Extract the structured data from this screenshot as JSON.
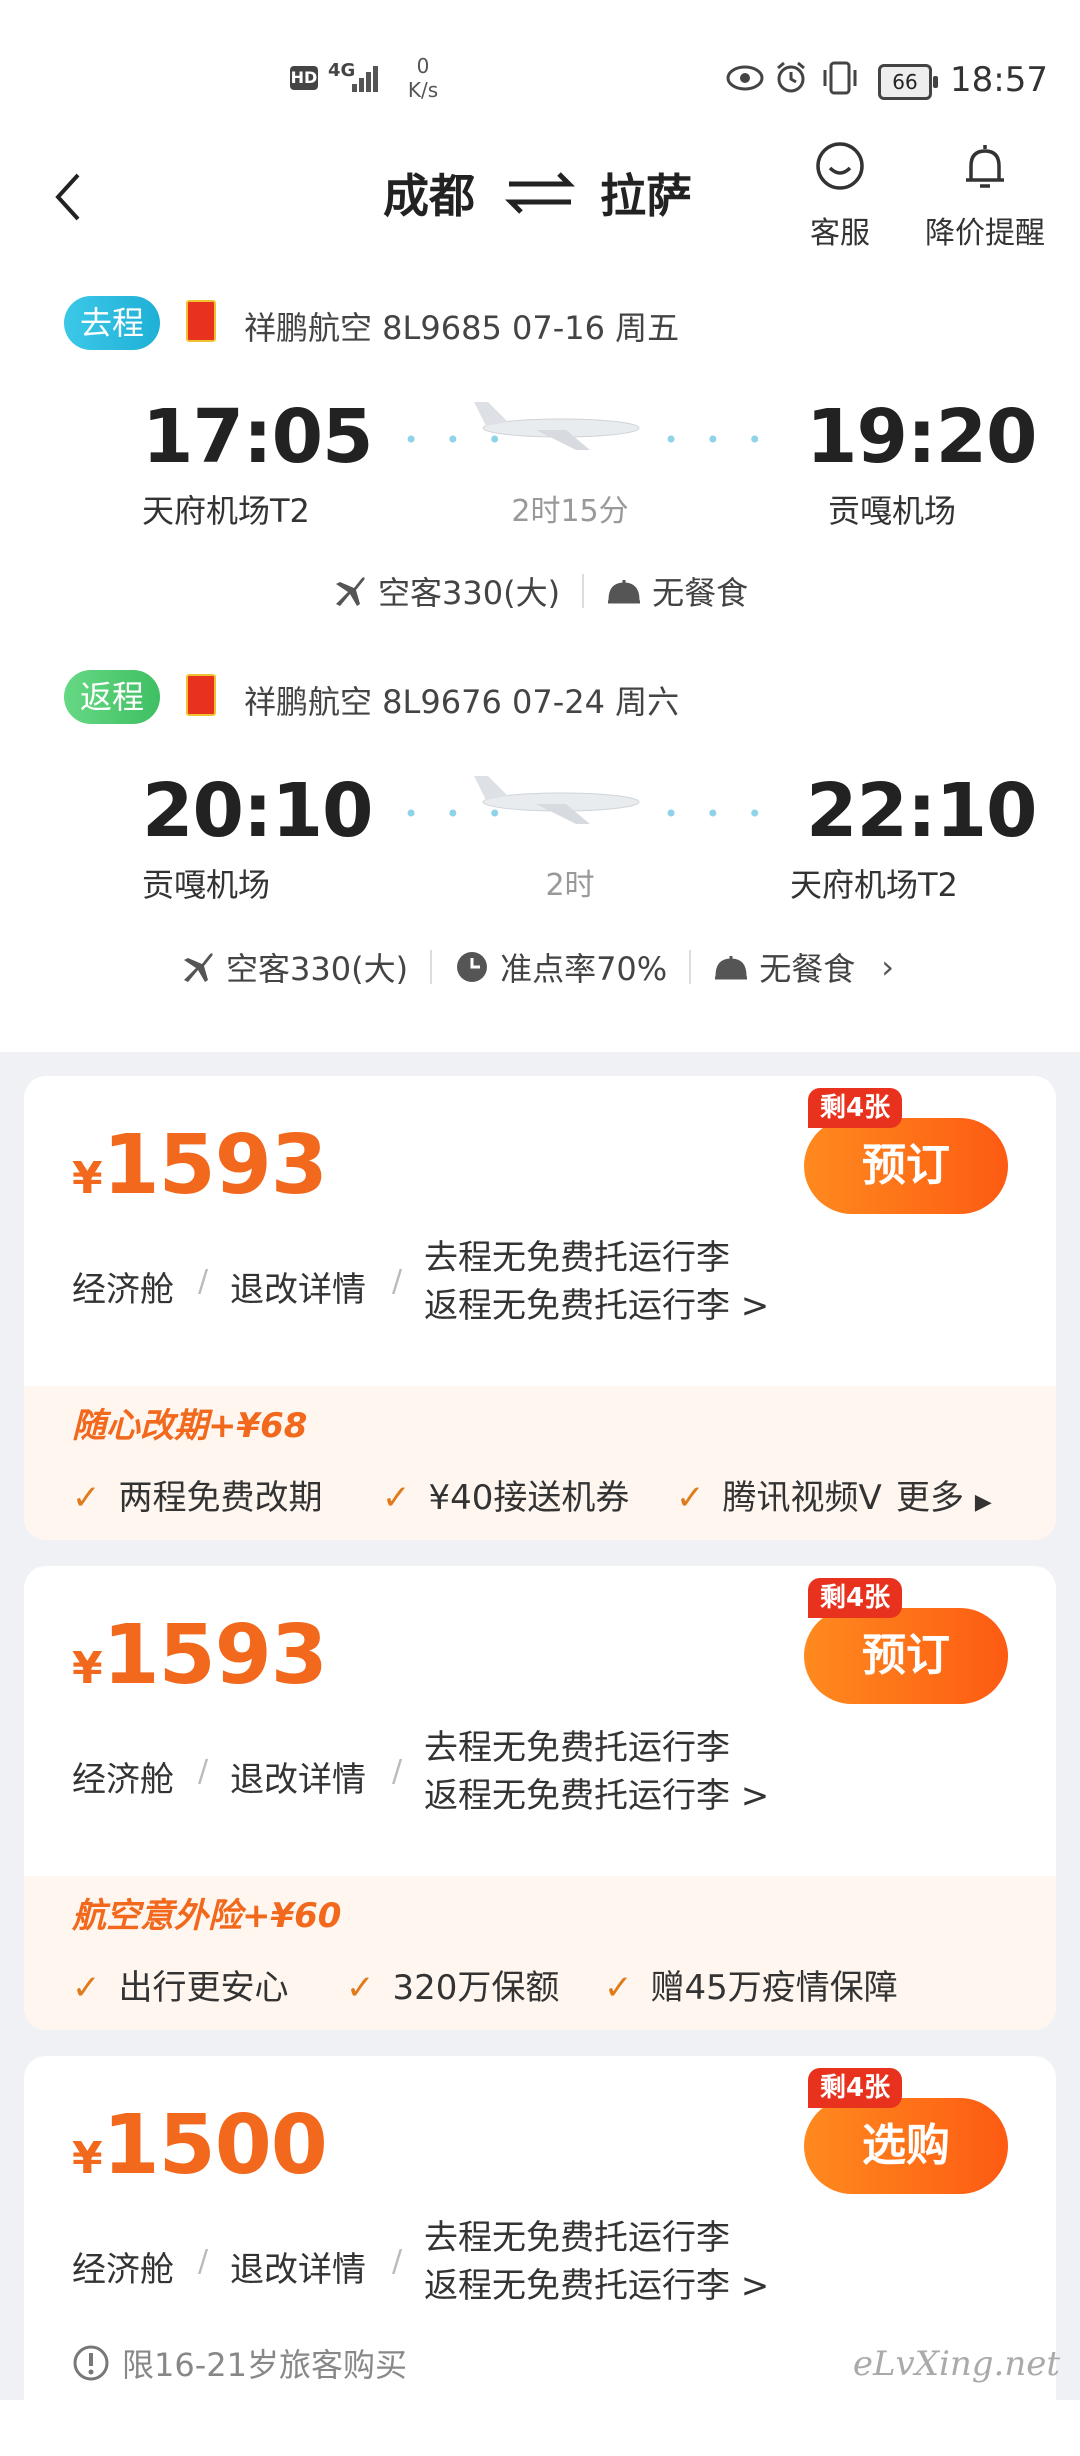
{
  "status_bar": {
    "network": "4G",
    "hd": "HD",
    "speed_value": "0",
    "speed_unit": "K/s",
    "battery": "66",
    "time": "18:57"
  },
  "header": {
    "origin": "成都",
    "destination": "拉萨",
    "service_label": "客服",
    "price_alert_label": "降价提醒"
  },
  "outbound": {
    "tag": "去程",
    "airline": "祥鹏航空 8L9685  07-16 周五",
    "dep_time": "17:05",
    "dep_airport": "天府机场T2",
    "duration": "2时15分",
    "arr_time": "19:20",
    "arr_airport": "贡嘎机场",
    "aircraft": "空客330(大)",
    "meal": "无餐食"
  },
  "return": {
    "tag": "返程",
    "airline": "祥鹏航空 8L9676  07-24 周六",
    "dep_time": "20:10",
    "dep_airport": "贡嘎机场",
    "duration": "2时",
    "arr_time": "22:10",
    "arr_airport": "天府机场T2",
    "aircraft": "空客330(大)",
    "ontime": "准点率70%",
    "meal": "无餐食"
  },
  "cards": [
    {
      "currency": "¥",
      "price": "1593",
      "remaining": "剩4张",
      "button": "预订",
      "cabin": "经济舱",
      "refund": "退改详情",
      "bag_out": "去程无免费托运行李",
      "bag_ret": "返程无免费托运行李 >",
      "promo_title": "随心改期+¥68",
      "promo_items": [
        "两程免费改期",
        "¥40接送机券",
        "腾讯视频V"
      ],
      "more": "更多"
    },
    {
      "currency": "¥",
      "price": "1593",
      "remaining": "剩4张",
      "button": "预订",
      "cabin": "经济舱",
      "refund": "退改详情",
      "bag_out": "去程无免费托运行李",
      "bag_ret": "返程无免费托运行李 >",
      "promo_title": "航空意外险+¥60",
      "promo_items": [
        "出行更安心",
        "320万保额",
        "赠45万疫情保障"
      ]
    },
    {
      "currency": "¥",
      "price": "1500",
      "remaining": "剩4张",
      "button": "选购",
      "cabin": "经济舱",
      "refund": "退改详情",
      "bag_out": "去程无免费托运行李",
      "bag_ret": "返程无免费托运行李 >",
      "note": "限16-21岁旅客购买"
    }
  ],
  "watermark": "eLvXing.net",
  "colors": {
    "accent_orange": "#f2681c",
    "outbound_tag": "#2bbfe0",
    "return_tag": "#5cd07a",
    "remain_badge": "#e8321e"
  }
}
